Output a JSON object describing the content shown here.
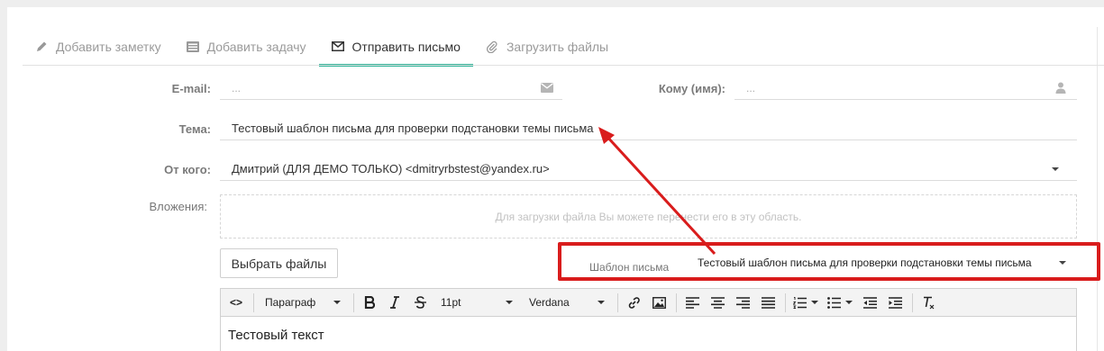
{
  "tabs": [
    {
      "label": "Добавить заметку",
      "icon": "pencil-icon"
    },
    {
      "label": "Добавить задачу",
      "icon": "task-list-icon"
    },
    {
      "label": "Отправить письмо",
      "icon": "envelope-icon",
      "active": true
    },
    {
      "label": "Загрузить файлы",
      "icon": "paperclip-icon"
    }
  ],
  "form": {
    "email_label": "E-mail:",
    "email_placeholder": "...",
    "to_label": "Кому (имя):",
    "to_placeholder": "...",
    "subject_label": "Тема:",
    "subject_value": "Тестовый шаблон письма для проверки подстановки темы письма",
    "from_label": "От кого:",
    "from_value": "Дмитрий (ДЛЯ ДЕМО ТОЛЬКО) <dmitryrbstest@yandex.ru>",
    "attachments_label": "Вложения:",
    "dropzone_text": "Для загрузки файла Вы можете перенести его в эту область.",
    "choose_files_label": "Выбрать файлы",
    "template_label": "Шаблон письма",
    "template_value": "Тестовый шаблон письма для проверки подстановки темы письма"
  },
  "editor": {
    "source_label": "<>",
    "paragraph_select": "Параграф",
    "font_size_select": "11pt",
    "font_family_select": "Verdana",
    "body_text": "Тестовый текст"
  },
  "colors": {
    "accent_green": "#2eb398",
    "highlight_red": "#d91c1c"
  }
}
